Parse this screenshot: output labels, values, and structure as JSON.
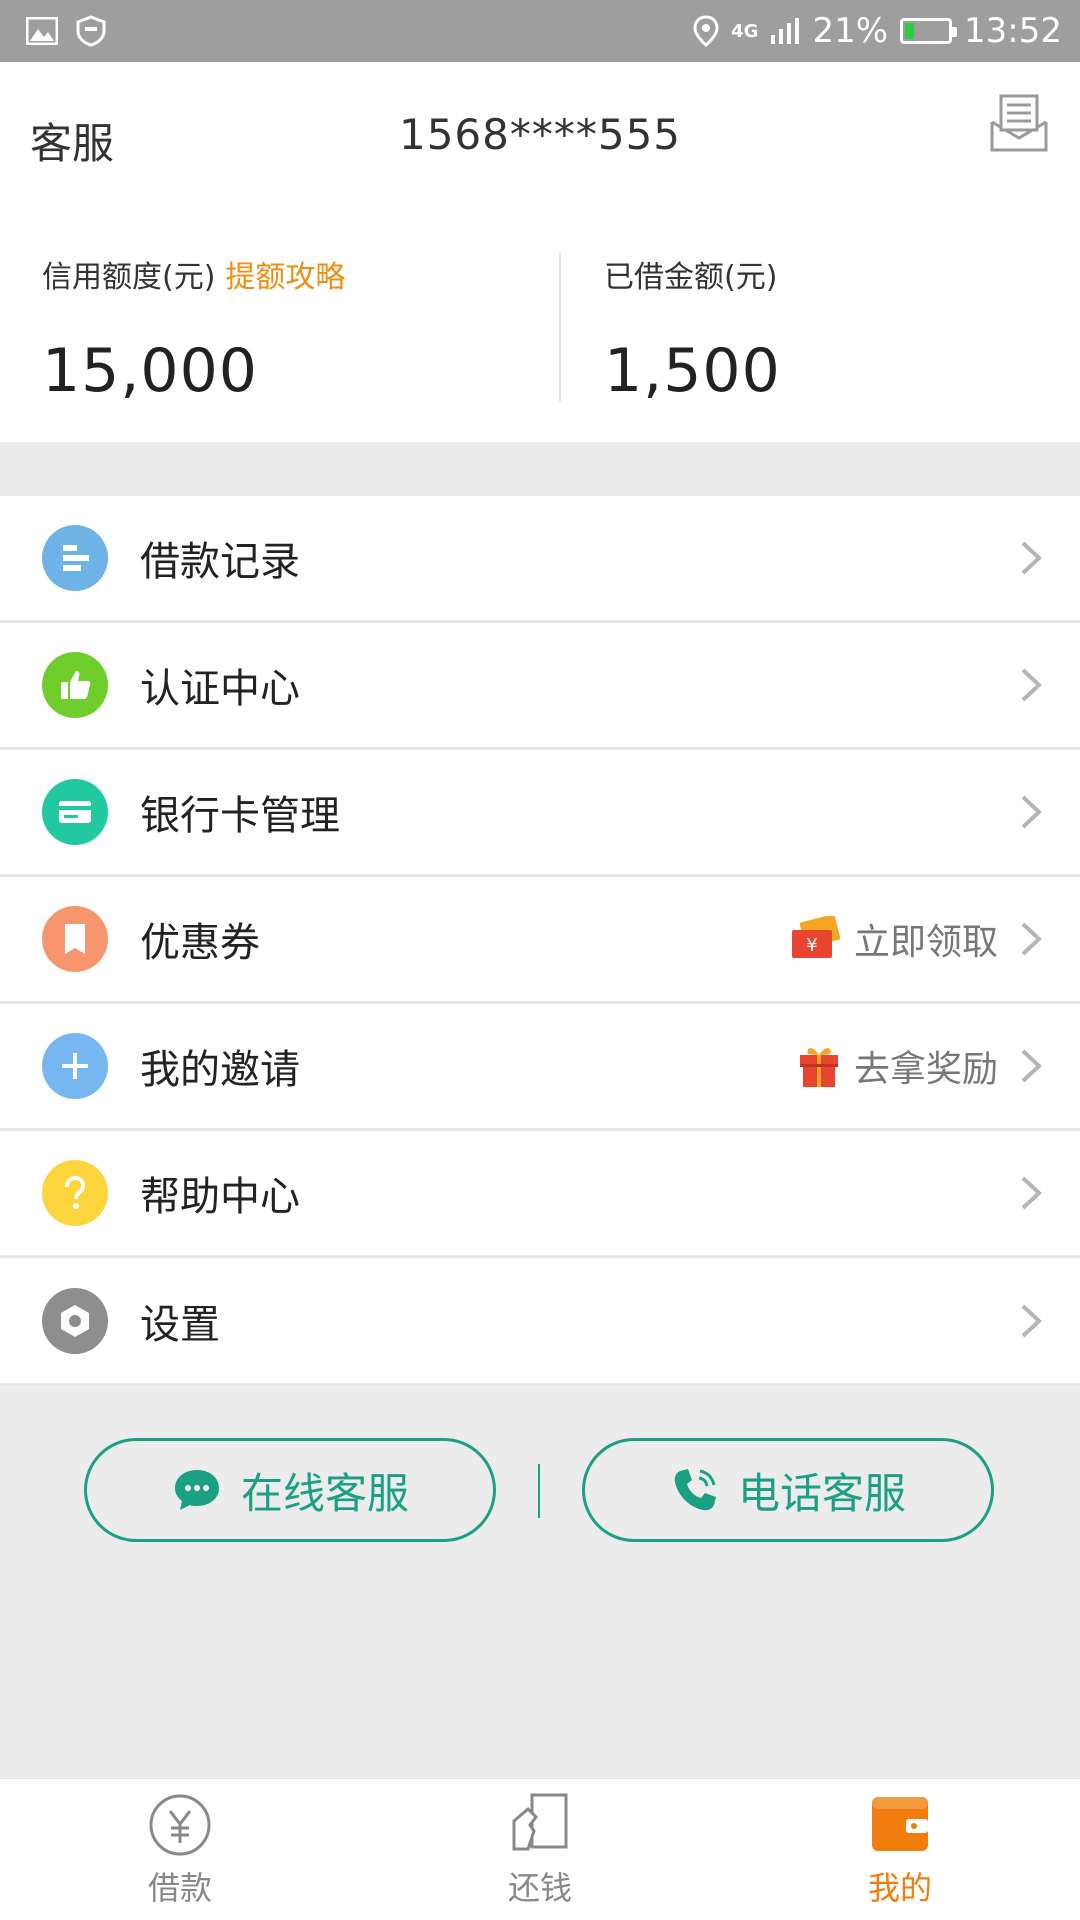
{
  "status_bar": {
    "network": "4G",
    "battery": "21%",
    "battery_level": 0.21,
    "time": "13:52",
    "icons": [
      "image-icon",
      "shield-icon",
      "location-icon",
      "signal-icon",
      "battery-icon"
    ]
  },
  "header": {
    "service_label": "客服",
    "phone": "1568****555",
    "message_icon": "mailbox-icon"
  },
  "stats": {
    "credit_label": "信用额度(元)",
    "credit_link": "提额攻略",
    "credit_value": "15,000",
    "borrowed_label": "已借金额(元)",
    "borrowed_value": "1,500"
  },
  "menu": {
    "items": [
      {
        "label": "借款记录",
        "icon": "list-icon",
        "color": "#6db3e6"
      },
      {
        "label": "认证中心",
        "icon": "thumb-up-icon",
        "color": "#6fcd2c"
      },
      {
        "label": "银行卡管理",
        "icon": "card-icon",
        "color": "#22c9a0"
      },
      {
        "label": "优惠券",
        "icon": "coupon-icon",
        "color": "#f6956e",
        "extra": "立即领取",
        "extra_icon": "ticket-icon"
      },
      {
        "label": "我的邀请",
        "icon": "plus-icon",
        "color": "#76b7f2",
        "extra": "去拿奖励",
        "extra_icon": "gift-icon"
      },
      {
        "label": "帮助中心",
        "icon": "question-icon",
        "color": "#fcd53c"
      },
      {
        "label": "设置",
        "icon": "gear-icon",
        "color": "#8e8e8e"
      }
    ]
  },
  "service": {
    "online_label": "在线客服",
    "phone_label": "电话客服"
  },
  "bottom_nav": {
    "items": [
      {
        "label": "借款",
        "icon": "yen-icon"
      },
      {
        "label": "还钱",
        "icon": "repay-icon"
      },
      {
        "label": "我的",
        "icon": "wallet-icon",
        "active": true
      }
    ]
  },
  "colors": {
    "accent": "#f07d0d",
    "green": "#1aa082",
    "link": "#f08e10"
  }
}
